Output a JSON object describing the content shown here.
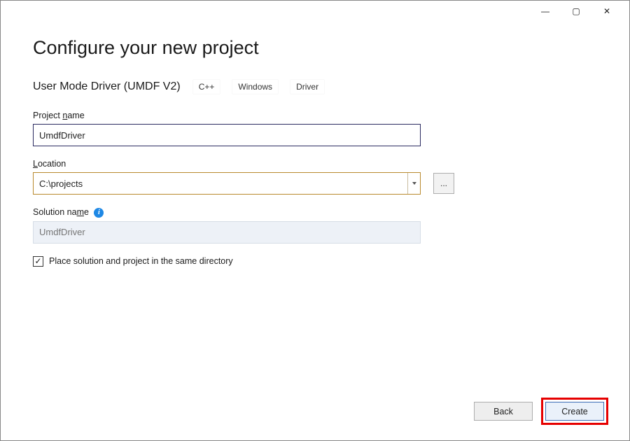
{
  "window_controls": {
    "minimize": "—",
    "maximize": "▢",
    "close": "✕"
  },
  "heading": "Configure your new project",
  "template_name": "User Mode Driver (UMDF V2)",
  "tags": [
    "C++",
    "Windows",
    "Driver"
  ],
  "fields": {
    "project_name": {
      "label_pre": "Project ",
      "label_ul": "n",
      "label_post": "ame",
      "value": "UmdfDriver"
    },
    "location": {
      "label_ul": "L",
      "label_post": "ocation",
      "value": "C:\\projects",
      "browse": "..."
    },
    "solution_name": {
      "label_pre": "Solution na",
      "label_ul": "m",
      "label_post": "e",
      "placeholder": "UmdfDriver"
    }
  },
  "checkbox": {
    "checked_glyph": "✓",
    "label_pre": "Place solution and project in the same ",
    "label_ul": "d",
    "label_post": "irectory"
  },
  "buttons": {
    "back_ul": "B",
    "back_post": "ack",
    "create_ul": "C",
    "create_post": "reate"
  },
  "info_glyph": "i"
}
